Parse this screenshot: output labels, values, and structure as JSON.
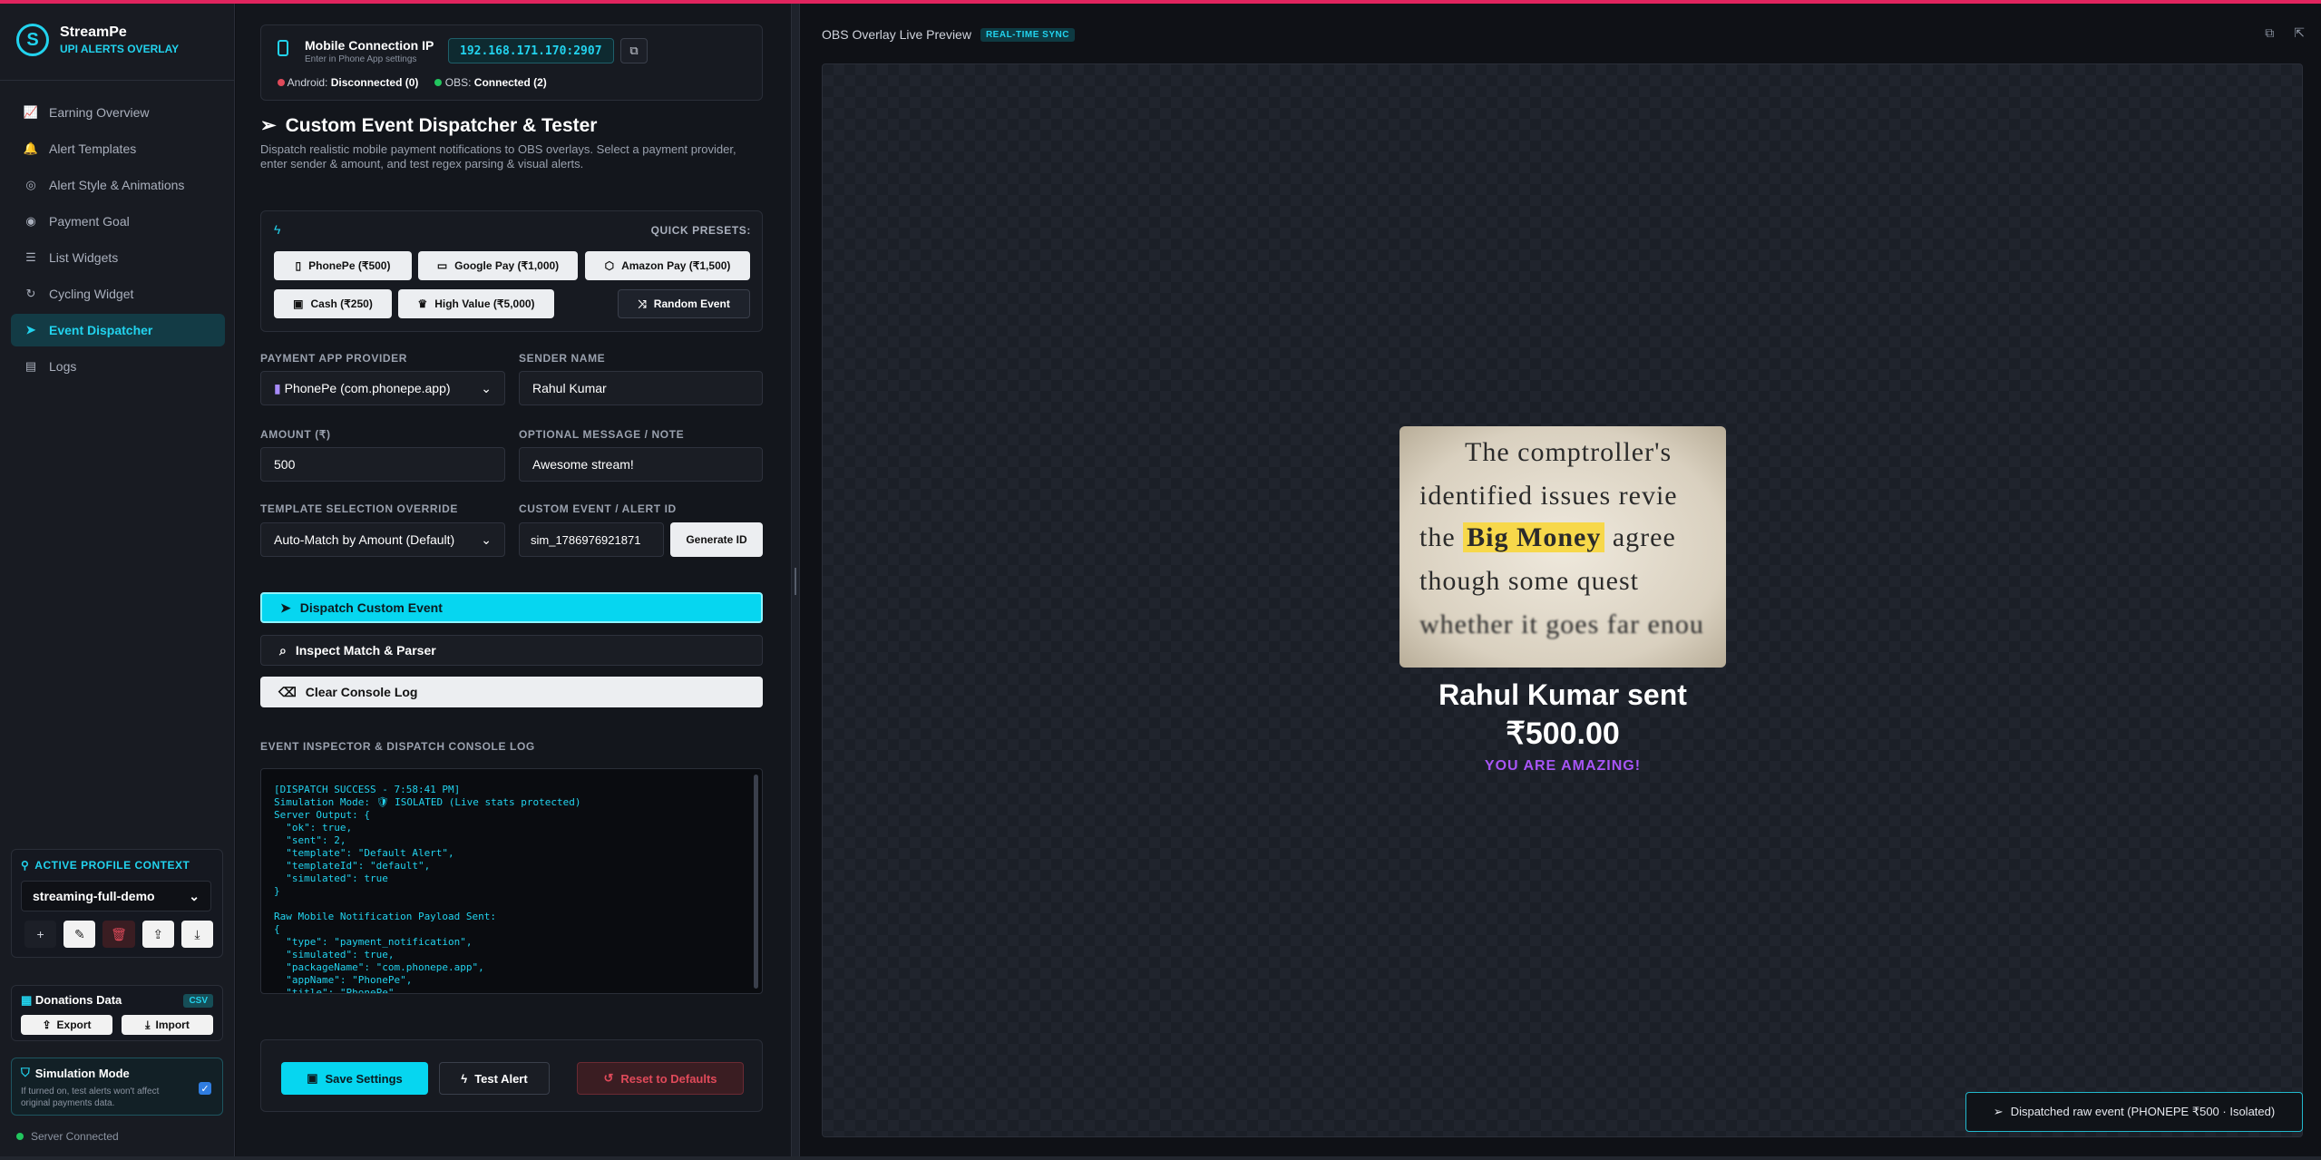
{
  "brand": {
    "name": "StreamPe",
    "subtitle": "UPI ALERTS OVERLAY"
  },
  "nav": [
    {
      "label": "Earning Overview",
      "icon": "chart-icon"
    },
    {
      "label": "Alert Templates",
      "icon": "bell-icon"
    },
    {
      "label": "Alert Style & Animations",
      "icon": "palette-icon"
    },
    {
      "label": "Payment Goal",
      "icon": "target-icon"
    },
    {
      "label": "List Widgets",
      "icon": "list-icon"
    },
    {
      "label": "Cycling Widget",
      "icon": "refresh-icon"
    },
    {
      "label": "Event Dispatcher",
      "icon": "send-icon",
      "active": true
    },
    {
      "label": "Logs",
      "icon": "clipboard-icon"
    }
  ],
  "profile": {
    "title": "ACTIVE PROFILE CONTEXT",
    "selected": "streaming-full-demo"
  },
  "donations": {
    "title": "Donations Data",
    "badge": "CSV",
    "export_label": "Export",
    "import_label": "Import"
  },
  "simulation": {
    "title": "Simulation Mode",
    "description": "If turned on, test alerts won't affect original payments data.",
    "checked": true
  },
  "server": {
    "status": "Server Connected"
  },
  "connection": {
    "title": "Mobile Connection IP",
    "subtitle": "Enter in Phone App settings",
    "ip": "192.168.171.170:2907",
    "android_label": "Android:",
    "android_status": "Disconnected (0)",
    "obs_label": "OBS:",
    "obs_status": "Connected (2)"
  },
  "dispatcher": {
    "title": "Custom Event Dispatcher & Tester",
    "description": "Dispatch realistic mobile payment notifications to OBS overlays. Select a payment provider, enter sender & amount, and test regex parsing & visual alerts."
  },
  "presets": {
    "label": "QUICK PRESETS:",
    "items": [
      "PhonePe (₹500)",
      "Google Pay (₹1,000)",
      "Amazon Pay (₹1,500)",
      "Cash (₹250)",
      "High Value (₹5,000)"
    ],
    "random_label": "Random Event"
  },
  "form": {
    "provider_label": "PAYMENT APP PROVIDER",
    "provider_value": "PhonePe (com.phonepe.app)",
    "sender_label": "SENDER NAME",
    "sender_value": "Rahul Kumar",
    "amount_label": "AMOUNT (₹)",
    "amount_value": "500",
    "message_label": "OPTIONAL MESSAGE / NOTE",
    "message_value": "Awesome stream!",
    "template_label": "TEMPLATE SELECTION OVERRIDE",
    "template_value": "Auto-Match by Amount (Default)",
    "event_id_label": "CUSTOM EVENT / ALERT ID",
    "event_id_value": "sim_1786976921871",
    "generate_label": "Generate ID"
  },
  "actions": {
    "dispatch": "Dispatch Custom Event",
    "inspect": "Inspect Match & Parser",
    "clear": "Clear Console Log"
  },
  "console": {
    "label": "EVENT INSPECTOR & DISPATCH CONSOLE LOG",
    "text": "[DISPATCH SUCCESS - 7:58:41 PM]\nSimulation Mode: 🛡 ISOLATED (Live stats protected)\nServer Output: {\n  \"ok\": true,\n  \"sent\": 2,\n  \"template\": \"Default Alert\",\n  \"templateId\": \"default\",\n  \"simulated\": true\n}\n\nRaw Mobile Notification Payload Sent:\n{\n  \"type\": \"payment_notification\",\n  \"simulated\": true,\n  \"packageName\": \"com.phonepe.app\",\n  \"appName\": \"PhonePe\",\n  \"title\": \"PhonePe\","
  },
  "footer": {
    "save": "Save Settings",
    "test": "Test Alert",
    "reset": "Reset to Defaults"
  },
  "preview": {
    "title": "OBS Overlay Live Preview",
    "badge": "REAL-TIME SYNC",
    "alert_name": "Rahul Kumar sent",
    "alert_amount": "₹500.00",
    "alert_message": "YOU ARE AMAZING!",
    "image_lines": [
      "The comptroller's",
      "identified issues revie",
      "the",
      "Big Money",
      "agree",
      "though some quest",
      "whether it goes far enou"
    ]
  },
  "toast": {
    "text": "Dispatched raw event (PHONEPE ₹500 · Isolated)"
  },
  "colors": {
    "accent": "#22d3ee",
    "danger": "#e04a5a",
    "success": "#22c55e",
    "topbar": "#e0245e",
    "message": "#a855f7"
  }
}
